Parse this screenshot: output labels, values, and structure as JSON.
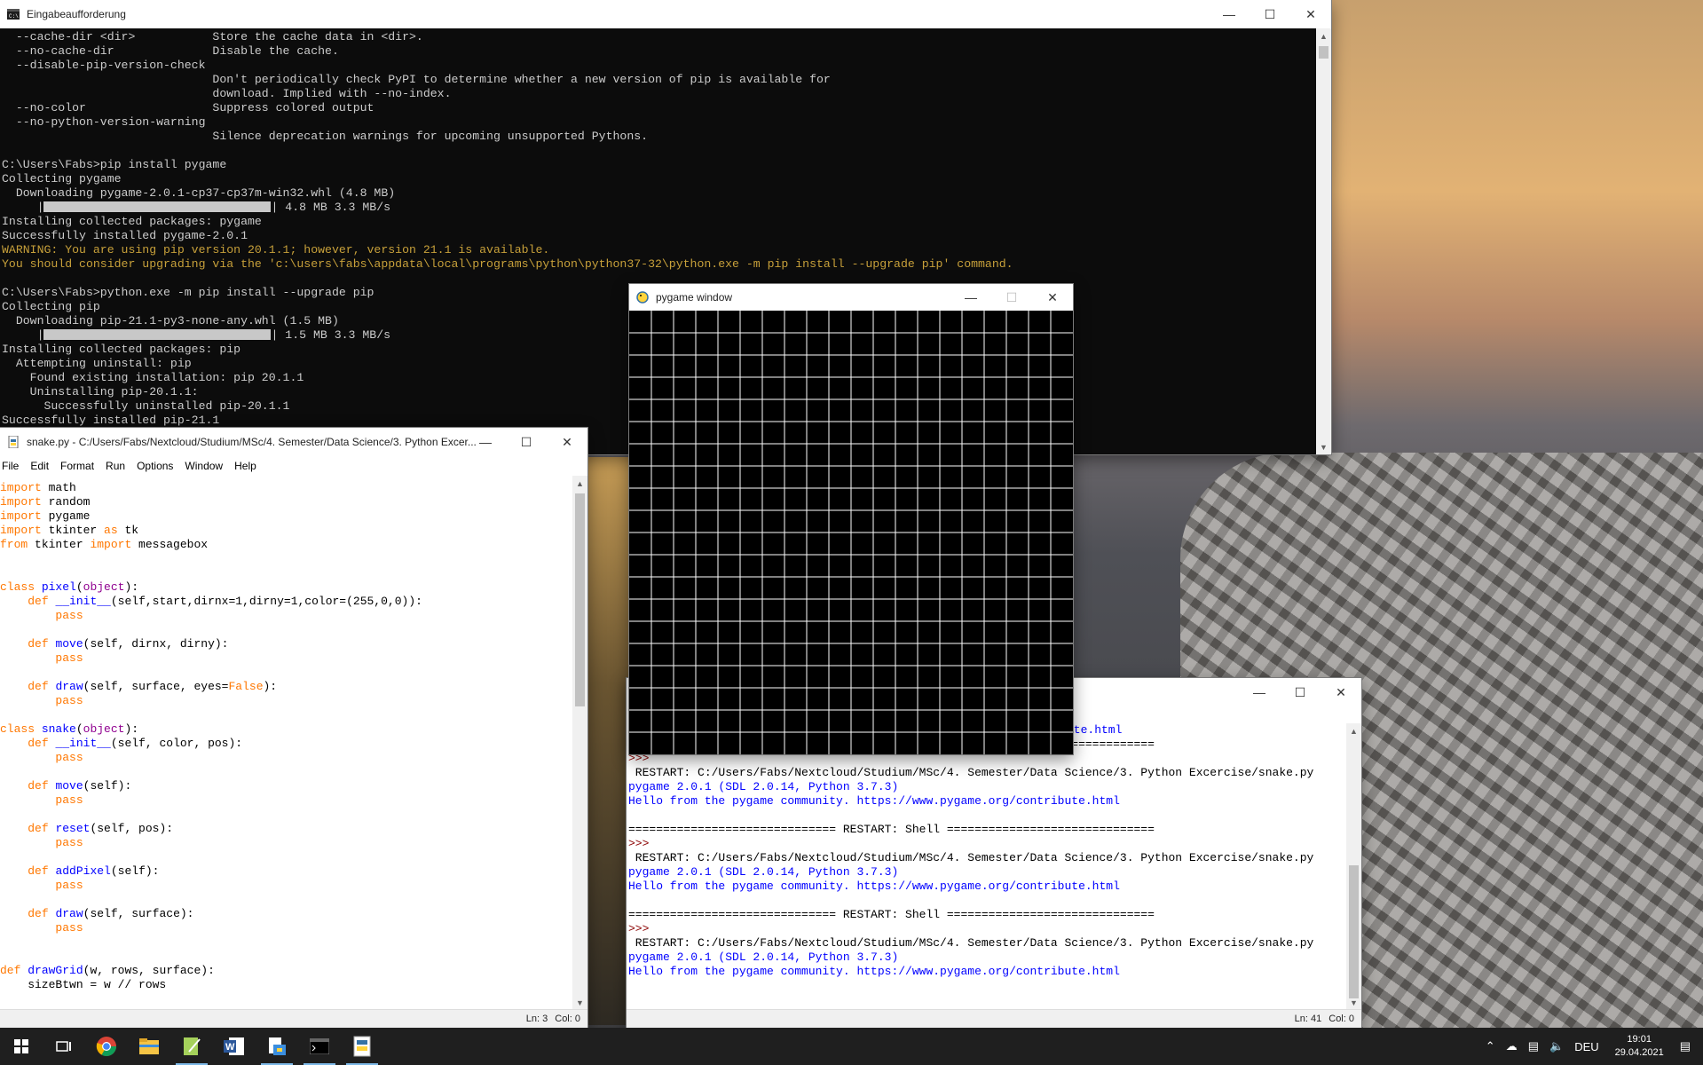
{
  "cmd": {
    "title": "Eingabeaufforderung",
    "lines": [
      "  --cache-dir <dir>           Store the cache data in <dir>.",
      "  --no-cache-dir              Disable the cache.",
      "  --disable-pip-version-check",
      "                              Don't periodically check PyPI to determine whether a new version of pip is available for",
      "                              download. Implied with --no-index.",
      "  --no-color                  Suppress colored output",
      "  --no-python-version-warning",
      "                              Silence deprecation warnings for upcoming unsupported Pythons.",
      "",
      "C:\\Users\\Fabs>pip install pygame",
      "Collecting pygame",
      "  Downloading pygame-2.0.1-cp37-cp37m-win32.whl (4.8 MB)",
      "@@BAR@@ 4.8 MB 3.3 MB/s",
      "Installing collected packages: pygame",
      "Successfully installed pygame-2.0.1",
      "WARNING: You are using pip version 20.1.1; however, version 21.1 is available.",
      "You should consider upgrading via the 'c:\\users\\fabs\\appdata\\local\\programs\\python\\python37-32\\python.exe -m pip install --upgrade pip' command.",
      "",
      "C:\\Users\\Fabs>python.exe -m pip install --upgrade pip",
      "Collecting pip",
      "  Downloading pip-21.1-py3-none-any.whl (1.5 MB)",
      "@@BAR@@ 1.5 MB 3.3 MB/s",
      "Installing collected packages: pip",
      "  Attempting uninstall: pip",
      "    Found existing installation: pip 20.1.1",
      "    Uninstalling pip-20.1.1:",
      "      Successfully uninstalled pip-20.1.1",
      "Successfully installed pip-21.1"
    ],
    "warning_line_indices": [
      15,
      16
    ],
    "progress_fraction": 1.0
  },
  "editor": {
    "title": "snake.py - C:/Users/Fabs/Nextcloud/Studium/MSc/4. Semester/Data Science/3. Python Excer...",
    "menu": [
      "File",
      "Edit",
      "Format",
      "Run",
      "Options",
      "Window",
      "Help"
    ],
    "status_ln": "Ln: 3",
    "status_col": "Col: 0",
    "code": [
      "import math",
      "import random",
      "import pygame",
      "import tkinter as tk",
      "from tkinter import messagebox",
      "",
      "",
      "class pixel(object):",
      "    def __init__(self,start,dirnx=1,dirny=1,color=(255,0,0)):",
      "        pass",
      "",
      "    def move(self, dirnx, dirny):",
      "        pass",
      "",
      "    def draw(self, surface, eyes=False):",
      "        pass",
      "",
      "class snake(object):",
      "    def __init__(self, color, pos):",
      "        pass",
      "",
      "    def move(self):",
      "        pass",
      "",
      "    def reset(self, pos):",
      "        pass",
      "",
      "    def addPixel(self):",
      "        pass",
      "",
      "    def draw(self, surface):",
      "        pass",
      "",
      "",
      "def drawGrid(w, rows, surface):",
      "    sizeBtwn = w // rows"
    ]
  },
  "pygame": {
    "title": "pygame window",
    "rows": 20
  },
  "shell": {
    "partial_top": "ute.html",
    "lines": [
      {
        "t": "sep",
        "text": "============================== RESTART: Shell =============================="
      },
      {
        "t": "prompt",
        "text": ">>> "
      },
      {
        "t": "restart",
        "text": " RESTART: C:/Users/Fabs/Nextcloud/Studium/MSc/4. Semester/Data Science/3. Python Excercise/snake.py"
      },
      {
        "t": "blue",
        "text": "pygame 2.0.1 (SDL 2.0.14, Python 3.7.3)"
      },
      {
        "t": "blue",
        "text": "Hello from the pygame community. https://www.pygame.org/contribute.html"
      },
      {
        "t": "blank",
        "text": ""
      },
      {
        "t": "sep",
        "text": "============================== RESTART: Shell =============================="
      },
      {
        "t": "prompt",
        "text": ">>> "
      },
      {
        "t": "restart",
        "text": " RESTART: C:/Users/Fabs/Nextcloud/Studium/MSc/4. Semester/Data Science/3. Python Excercise/snake.py"
      },
      {
        "t": "blue",
        "text": "pygame 2.0.1 (SDL 2.0.14, Python 3.7.3)"
      },
      {
        "t": "blue",
        "text": "Hello from the pygame community. https://www.pygame.org/contribute.html"
      },
      {
        "t": "blank",
        "text": ""
      },
      {
        "t": "sep",
        "text": "============================== RESTART: Shell =============================="
      },
      {
        "t": "prompt",
        "text": ">>> "
      },
      {
        "t": "restart",
        "text": " RESTART: C:/Users/Fabs/Nextcloud/Studium/MSc/4. Semester/Data Science/3. Python Excercise/snake.py"
      },
      {
        "t": "blue",
        "text": "pygame 2.0.1 (SDL 2.0.14, Python 3.7.3)"
      },
      {
        "t": "blue",
        "text": "Hello from the pygame community. https://www.pygame.org/contribute.html"
      }
    ],
    "status_ln": "Ln: 41",
    "status_col": "Col: 0"
  },
  "taskbar": {
    "apps": [
      "start-icon",
      "task-view-icon",
      "chrome-icon",
      "file-explorer-icon",
      "notepad-icon",
      "word-icon",
      "paint-icon",
      "terminal-icon",
      "idle-icon"
    ],
    "language": "DEU",
    "time": "19:01",
    "date": "29.04.2021"
  },
  "colors": {
    "console_bg": "#0c0c0c",
    "console_fg": "#cccccc",
    "warning": "#c7a03a",
    "idle_keyword": "#ff7700",
    "idle_def": "#0000ff",
    "shell_output": "#0000ff"
  }
}
